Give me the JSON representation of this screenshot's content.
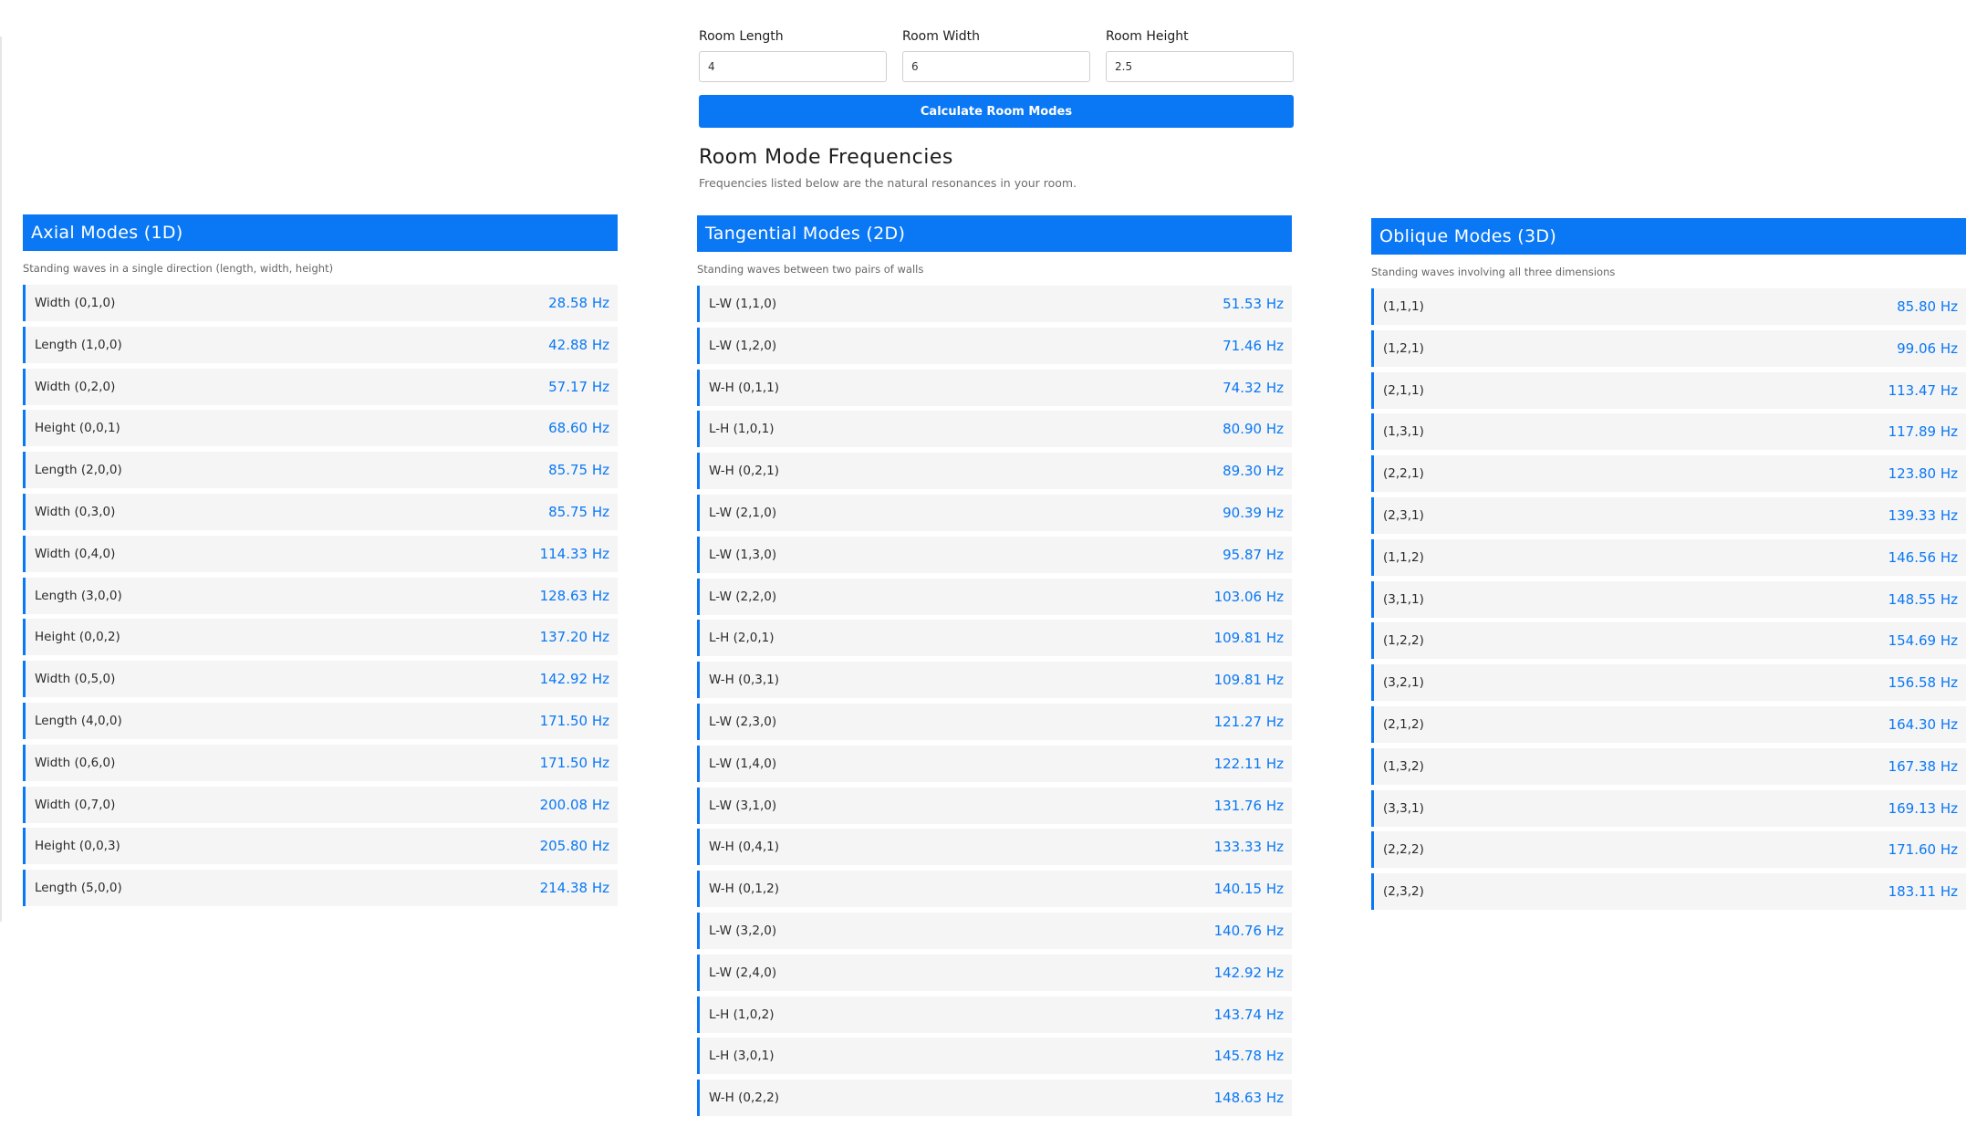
{
  "form": {
    "length": {
      "label": "Room Length",
      "value": "4"
    },
    "width": {
      "label": "Room Width",
      "value": "6"
    },
    "height": {
      "label": "Room Height",
      "value": "2.5"
    },
    "button_label": "Calculate Room Modes"
  },
  "results": {
    "title": "Room Mode Frequencies",
    "description": "Frequencies listed below are the natural resonances in your room."
  },
  "axial": {
    "title": "Axial Modes (1D)",
    "description": "Standing waves in a single direction (length, width, height)",
    "modes": [
      {
        "name": "Width (0,1,0)",
        "freq": "28.58 Hz"
      },
      {
        "name": "Length (1,0,0)",
        "freq": "42.88 Hz"
      },
      {
        "name": "Width (0,2,0)",
        "freq": "57.17 Hz"
      },
      {
        "name": "Height (0,0,1)",
        "freq": "68.60 Hz"
      },
      {
        "name": "Length (2,0,0)",
        "freq": "85.75 Hz"
      },
      {
        "name": "Width (0,3,0)",
        "freq": "85.75 Hz"
      },
      {
        "name": "Width (0,4,0)",
        "freq": "114.33 Hz"
      },
      {
        "name": "Length (3,0,0)",
        "freq": "128.63 Hz"
      },
      {
        "name": "Height (0,0,2)",
        "freq": "137.20 Hz"
      },
      {
        "name": "Width (0,5,0)",
        "freq": "142.92 Hz"
      },
      {
        "name": "Length (4,0,0)",
        "freq": "171.50 Hz"
      },
      {
        "name": "Width (0,6,0)",
        "freq": "171.50 Hz"
      },
      {
        "name": "Width (0,7,0)",
        "freq": "200.08 Hz"
      },
      {
        "name": "Height (0,0,3)",
        "freq": "205.80 Hz"
      },
      {
        "name": "Length (5,0,0)",
        "freq": "214.38 Hz"
      }
    ]
  },
  "tangential": {
    "title": "Tangential Modes (2D)",
    "description": "Standing waves between two pairs of walls",
    "modes": [
      {
        "name": "L-W (1,1,0)",
        "freq": "51.53 Hz"
      },
      {
        "name": "L-W (1,2,0)",
        "freq": "71.46 Hz"
      },
      {
        "name": "W-H (0,1,1)",
        "freq": "74.32 Hz"
      },
      {
        "name": "L-H (1,0,1)",
        "freq": "80.90 Hz"
      },
      {
        "name": "W-H (0,2,1)",
        "freq": "89.30 Hz"
      },
      {
        "name": "L-W (2,1,0)",
        "freq": "90.39 Hz"
      },
      {
        "name": "L-W (1,3,0)",
        "freq": "95.87 Hz"
      },
      {
        "name": "L-W (2,2,0)",
        "freq": "103.06 Hz"
      },
      {
        "name": "L-H (2,0,1)",
        "freq": "109.81 Hz"
      },
      {
        "name": "W-H (0,3,1)",
        "freq": "109.81 Hz"
      },
      {
        "name": "L-W (2,3,0)",
        "freq": "121.27 Hz"
      },
      {
        "name": "L-W (1,4,0)",
        "freq": "122.11 Hz"
      },
      {
        "name": "L-W (3,1,0)",
        "freq": "131.76 Hz"
      },
      {
        "name": "W-H (0,4,1)",
        "freq": "133.33 Hz"
      },
      {
        "name": "W-H (0,1,2)",
        "freq": "140.15 Hz"
      },
      {
        "name": "L-W (3,2,0)",
        "freq": "140.76 Hz"
      },
      {
        "name": "L-W (2,4,0)",
        "freq": "142.92 Hz"
      },
      {
        "name": "L-H (1,0,2)",
        "freq": "143.74 Hz"
      },
      {
        "name": "L-H (3,0,1)",
        "freq": "145.78 Hz"
      },
      {
        "name": "W-H (0,2,2)",
        "freq": "148.63 Hz"
      }
    ]
  },
  "oblique": {
    "title": "Oblique Modes (3D)",
    "description": "Standing waves involving all three dimensions",
    "modes": [
      {
        "name": "(1,1,1)",
        "freq": "85.80 Hz"
      },
      {
        "name": "(1,2,1)",
        "freq": "99.06 Hz"
      },
      {
        "name": "(2,1,1)",
        "freq": "113.47 Hz"
      },
      {
        "name": "(1,3,1)",
        "freq": "117.89 Hz"
      },
      {
        "name": "(2,2,1)",
        "freq": "123.80 Hz"
      },
      {
        "name": "(2,3,1)",
        "freq": "139.33 Hz"
      },
      {
        "name": "(1,1,2)",
        "freq": "146.56 Hz"
      },
      {
        "name": "(3,1,1)",
        "freq": "148.55 Hz"
      },
      {
        "name": "(1,2,2)",
        "freq": "154.69 Hz"
      },
      {
        "name": "(3,2,1)",
        "freq": "156.58 Hz"
      },
      {
        "name": "(2,1,2)",
        "freq": "164.30 Hz"
      },
      {
        "name": "(1,3,2)",
        "freq": "167.38 Hz"
      },
      {
        "name": "(3,3,1)",
        "freq": "169.13 Hz"
      },
      {
        "name": "(2,2,2)",
        "freq": "171.60 Hz"
      },
      {
        "name": "(2,3,2)",
        "freq": "183.11 Hz"
      }
    ]
  },
  "colors": {
    "accent": "#0a78f5",
    "row_background": "#f5f5f5"
  }
}
